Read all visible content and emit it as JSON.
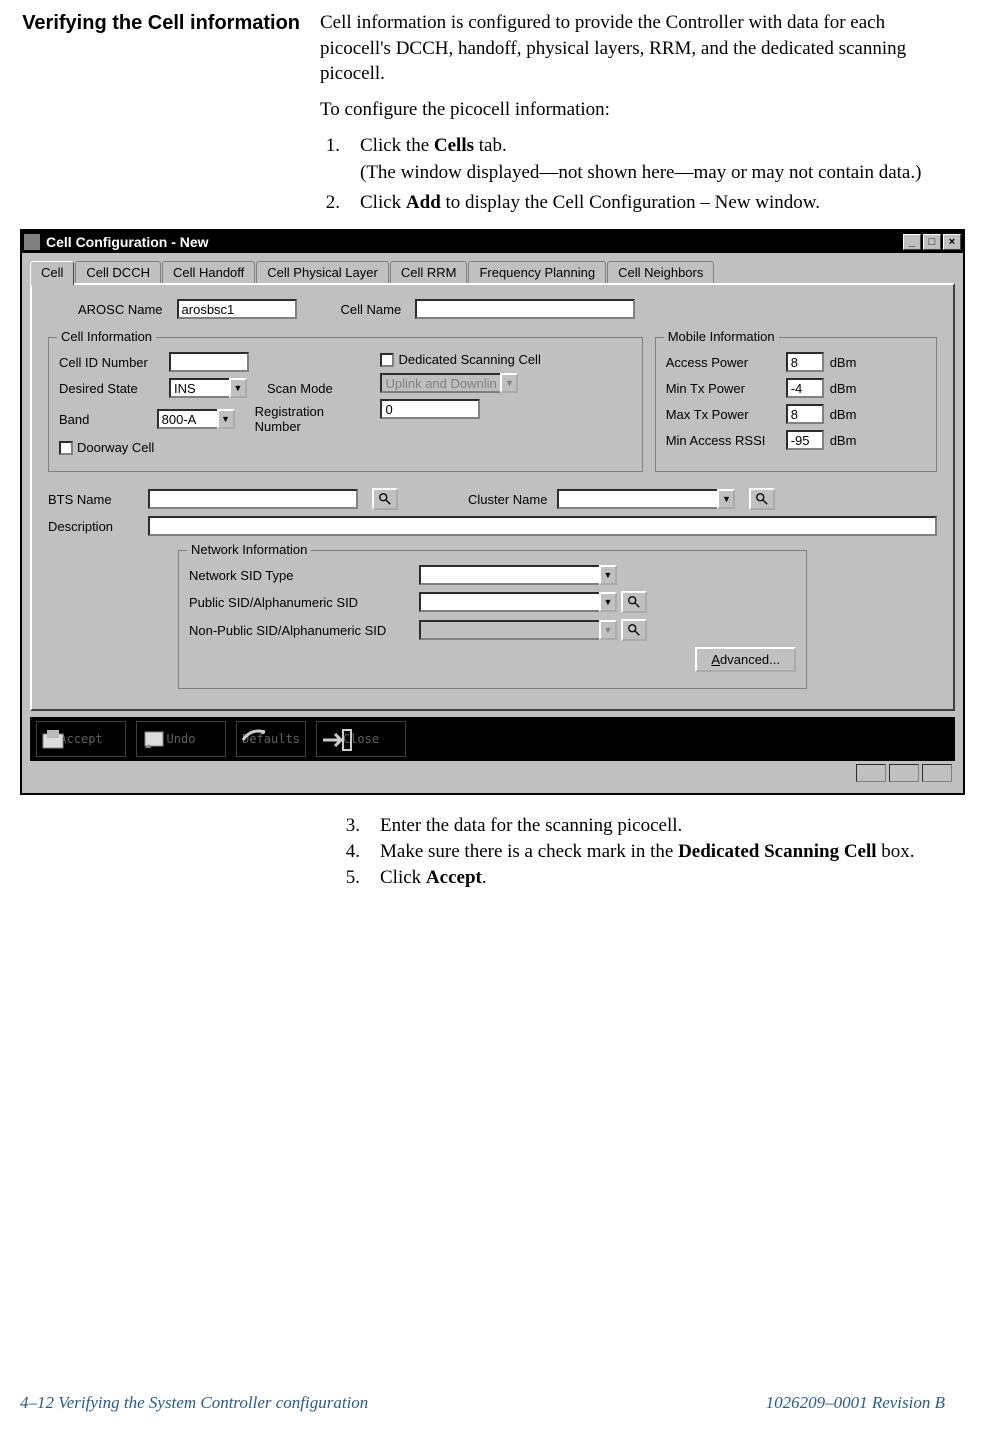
{
  "heading": "Verifying the Cell information",
  "intro_p1": "Cell information is configured to provide the Controller with data for each picocell's DCCH, handoff, physical layers, RRM, and the dedicated scanning picocell.",
  "intro_p2": "To configure the picocell information:",
  "steps_top": [
    {
      "n": "1.",
      "text_pre": "Click the ",
      "bold": "Cells",
      "text_post": " tab.",
      "sub": "(The window displayed—not shown here—may or may not contain data.)"
    },
    {
      "n": "2.",
      "text_pre": "Click ",
      "bold": "Add",
      "text_post": " to display the Cell Configuration – New window."
    }
  ],
  "window": {
    "title": "Cell Configuration - New",
    "tabs": [
      "Cell",
      "Cell DCCH",
      "Cell Handoff",
      "Cell Physical Layer",
      "Cell RRM",
      "Frequency Planning",
      "Cell Neighbors"
    ],
    "arosc_label": "AROSC Name",
    "arosc_value": "arosbsc1",
    "cellname_label": "Cell Name",
    "cellname_value": "",
    "group_cellinfo": "Cell Information",
    "cellid_label": "Cell ID Number",
    "cellid_value": "",
    "desired_label": "Desired State",
    "desired_value": "INS",
    "band_label": "Band",
    "band_value": "800-A",
    "doorway_label": "Doorway Cell",
    "dedicated_label": "Dedicated Scanning Cell",
    "scanmode_label": "Scan Mode",
    "scanmode_value": "Uplink and Downlin",
    "regnum_label": "Registration Number",
    "regnum_value": "0",
    "group_mobile": "Mobile Information",
    "access_power_label": "Access Power",
    "access_power_value": "8",
    "min_tx_label": "Min Tx Power",
    "min_tx_value": "-4",
    "max_tx_label": "Max Tx Power",
    "max_tx_value": "8",
    "min_rssi_label": "Min Access RSSI",
    "min_rssi_value": "-95",
    "dbm": "dBm",
    "bts_label": "BTS Name",
    "bts_value": "",
    "cluster_label": "Cluster Name",
    "cluster_value": "",
    "desc_label": "Description",
    "desc_value": "",
    "group_network": "Network Information",
    "net_sid_type_label": "Network SID Type",
    "public_sid_label": "Public SID/Alphanumeric SID",
    "nonpublic_sid_label": "Non-Public SID/Alphanumeric SID",
    "advanced_label": "Advanced...",
    "toolbar": {
      "accept": "Accept",
      "undo": "Undo",
      "defaults": "Defaults",
      "close": "Close"
    }
  },
  "steps_bottom": [
    {
      "n": "3.",
      "text": "Enter the data for the scanning picocell."
    },
    {
      "n": "4.",
      "text_pre": "Make sure there is a check mark in the ",
      "bold": "Dedicated Scanning Cell",
      "text_post": " box."
    },
    {
      "n": "5.",
      "text_pre": "Click ",
      "bold": "Accept",
      "text_post": "."
    }
  ],
  "footer_left": "4–12  Verifying the System Controller configuration",
  "footer_right": "1026209–0001  Revision B"
}
